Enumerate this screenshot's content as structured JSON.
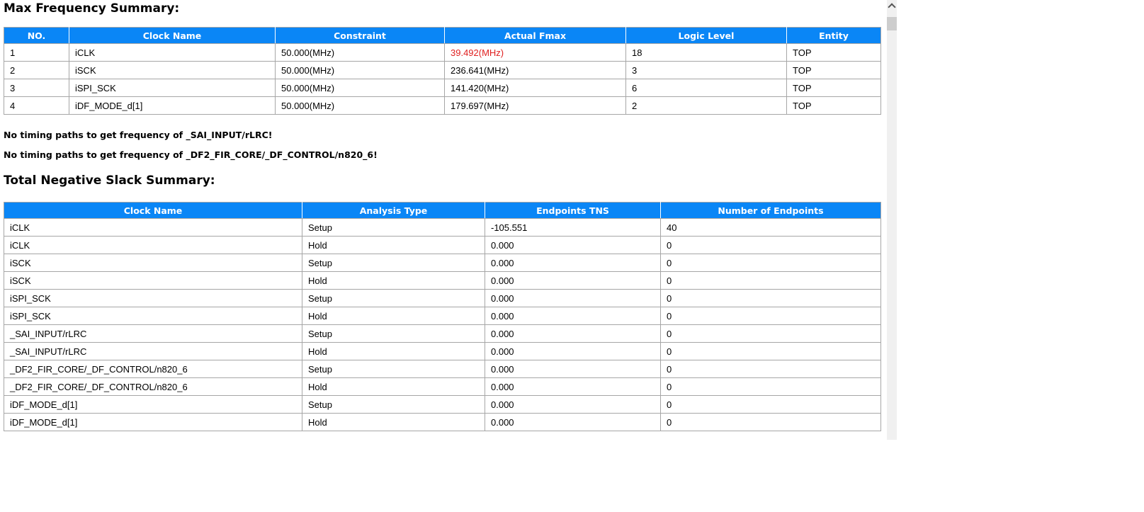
{
  "report": {
    "max_freq": {
      "title": "Max Frequency Summary:",
      "columns": [
        "NO.",
        "Clock Name",
        "Constraint",
        "Actual Fmax",
        "Logic Level",
        "Entity"
      ],
      "rows": [
        {
          "no": "1",
          "clock": "iCLK",
          "constraint": "50.000(MHz)",
          "fmax": "39.492(MHz)",
          "fmax_class": "alert",
          "logic": "18",
          "entity": "TOP"
        },
        {
          "no": "2",
          "clock": "iSCK",
          "constraint": "50.000(MHz)",
          "fmax": "236.641(MHz)",
          "logic": "3",
          "entity": "TOP"
        },
        {
          "no": "3",
          "clock": "iSPI_SCK",
          "constraint": "50.000(MHz)",
          "fmax": "141.420(MHz)",
          "logic": "6",
          "entity": "TOP"
        },
        {
          "no": "4",
          "clock": "iDF_MODE_d[1]",
          "constraint": "50.000(MHz)",
          "fmax": "179.697(MHz)",
          "logic": "2",
          "entity": "TOP"
        }
      ]
    },
    "messages": [
      "No timing paths to get frequency of _SAI_INPUT/rLRC!",
      "No timing paths to get frequency of _DF2_FIR_CORE/_DF_CONTROL/n820_6!"
    ],
    "tns": {
      "title": "Total Negative Slack Summary:",
      "columns": [
        "Clock Name",
        "Analysis Type",
        "Endpoints TNS",
        "Number of Endpoints"
      ],
      "rows": [
        {
          "clock": "iCLK",
          "analysis": "Setup",
          "tns": "-105.551",
          "endpoints": "40"
        },
        {
          "clock": "iCLK",
          "analysis": "Hold",
          "tns": "0.000",
          "endpoints": "0"
        },
        {
          "clock": "iSCK",
          "analysis": "Setup",
          "tns": "0.000",
          "endpoints": "0"
        },
        {
          "clock": "iSCK",
          "analysis": "Hold",
          "tns": "0.000",
          "endpoints": "0"
        },
        {
          "clock": "iSPI_SCK",
          "analysis": "Setup",
          "tns": "0.000",
          "endpoints": "0"
        },
        {
          "clock": "iSPI_SCK",
          "analysis": "Hold",
          "tns": "0.000",
          "endpoints": "0"
        },
        {
          "clock": "_SAI_INPUT/rLRC",
          "analysis": "Setup",
          "tns": "0.000",
          "endpoints": "0"
        },
        {
          "clock": "_SAI_INPUT/rLRC",
          "analysis": "Hold",
          "tns": "0.000",
          "endpoints": "0"
        },
        {
          "clock": "_DF2_FIR_CORE/_DF_CONTROL/n820_6",
          "analysis": "Setup",
          "tns": "0.000",
          "endpoints": "0"
        },
        {
          "clock": "_DF2_FIR_CORE/_DF_CONTROL/n820_6",
          "analysis": "Hold",
          "tns": "0.000",
          "endpoints": "0"
        },
        {
          "clock": "iDF_MODE_d[1]",
          "analysis": "Setup",
          "tns": "0.000",
          "endpoints": "0"
        },
        {
          "clock": "iDF_MODE_d[1]",
          "analysis": "Hold",
          "tns": "0.000",
          "endpoints": "0"
        }
      ]
    },
    "colors": {
      "header_bg": "#0a86f6",
      "header_text": "#ffffff",
      "alert_text": "#e02020",
      "table_border": "#a6a6a6",
      "scroll_track": "#f0f0f0",
      "scroll_thumb": "#cdcdcd"
    }
  }
}
